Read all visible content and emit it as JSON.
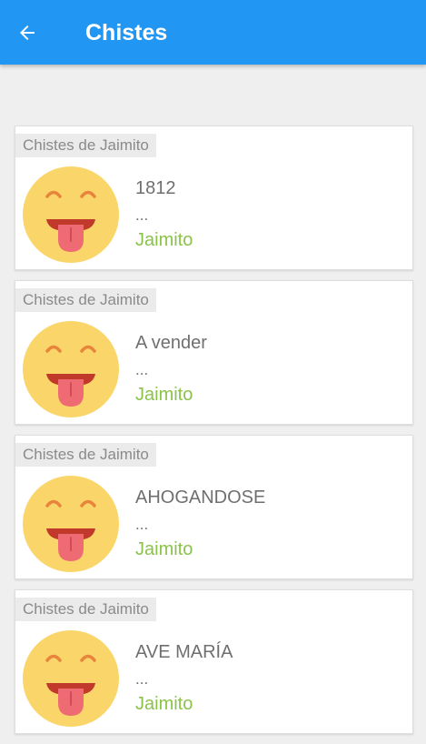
{
  "appbar": {
    "title": "Chistes"
  },
  "jokes": [
    {
      "category": "Chistes de Jaimito",
      "title": "1812",
      "preview": "...",
      "author": "Jaimito"
    },
    {
      "category": "Chistes de Jaimito",
      "title": "A vender",
      "preview": "...",
      "author": "Jaimito"
    },
    {
      "category": "Chistes de Jaimito",
      "title": "AHOGANDOSE",
      "preview": "...",
      "author": "Jaimito"
    },
    {
      "category": "Chistes de Jaimito",
      "title": "AVE MARÍA",
      "preview": "...",
      "author": "Jaimito"
    }
  ],
  "icons": {
    "back": "arrow-left-icon",
    "avatar": "tongue-out-emoji-icon"
  },
  "colors": {
    "appbar": "#2196f3",
    "author": "#8bc34a",
    "emoji_face": "#fad66a"
  }
}
